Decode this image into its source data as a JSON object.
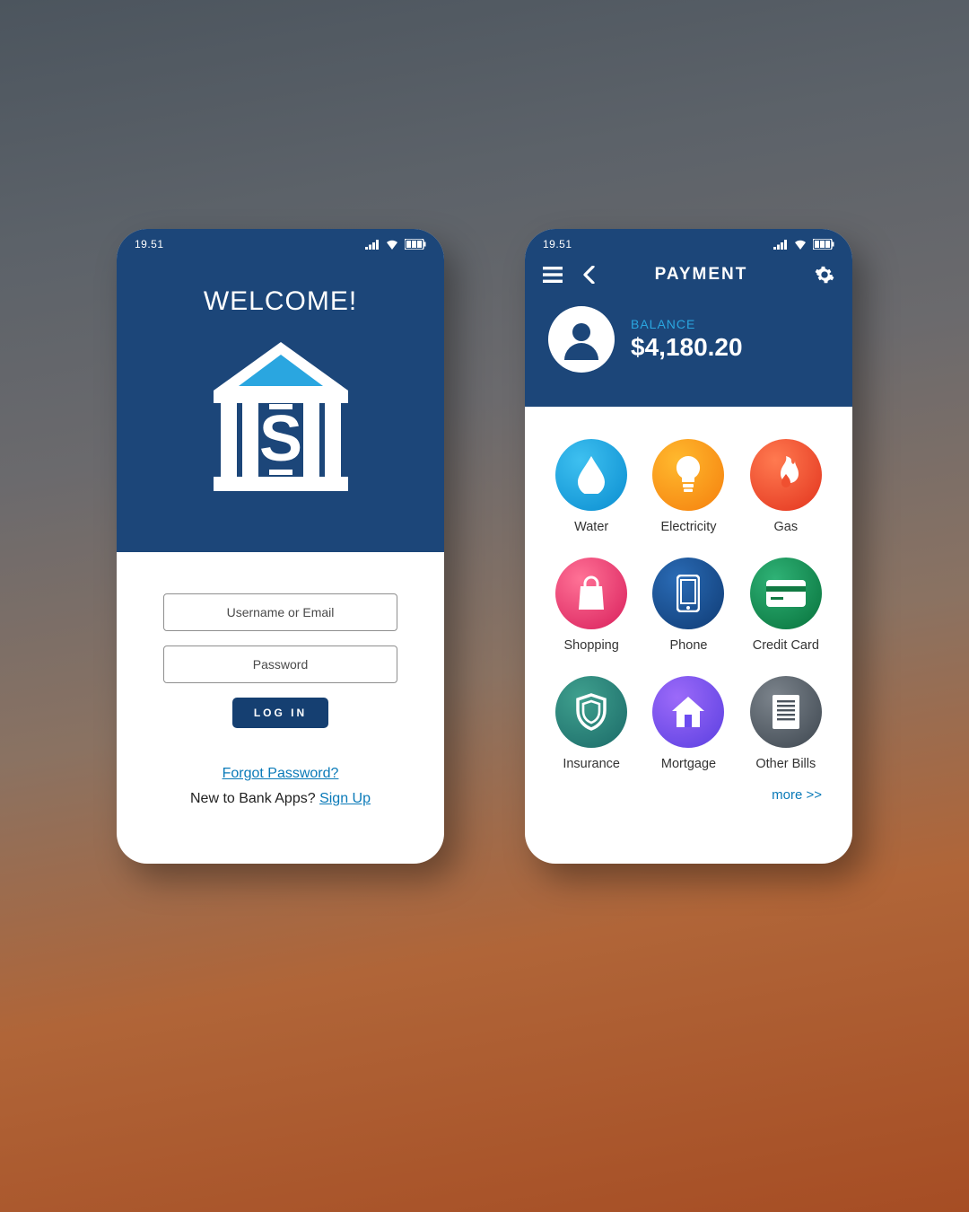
{
  "status": {
    "time": "19.51"
  },
  "login": {
    "welcome": "WELCOME!",
    "username_placeholder": "Username or Email",
    "password_placeholder": "Password",
    "login_button": "LOG IN",
    "forgot": "Forgot Password?",
    "new_text": "New to Bank Apps? ",
    "signup": "Sign Up"
  },
  "payment": {
    "title": "PAYMENT",
    "balance_label": "BALANCE",
    "balance_value": "$4,180.20",
    "categories": [
      {
        "label": "Water",
        "icon": "water-icon"
      },
      {
        "label": "Electricity",
        "icon": "electricity-icon"
      },
      {
        "label": "Gas",
        "icon": "gas-icon"
      },
      {
        "label": "Shopping",
        "icon": "shopping-icon"
      },
      {
        "label": "Phone",
        "icon": "phone-icon"
      },
      {
        "label": "Credit Card",
        "icon": "credit-card-icon"
      },
      {
        "label": "Insurance",
        "icon": "insurance-icon"
      },
      {
        "label": "Mortgage",
        "icon": "mortgage-icon"
      },
      {
        "label": "Other Bills",
        "icon": "other-bills-icon"
      }
    ],
    "more": "more >>"
  }
}
